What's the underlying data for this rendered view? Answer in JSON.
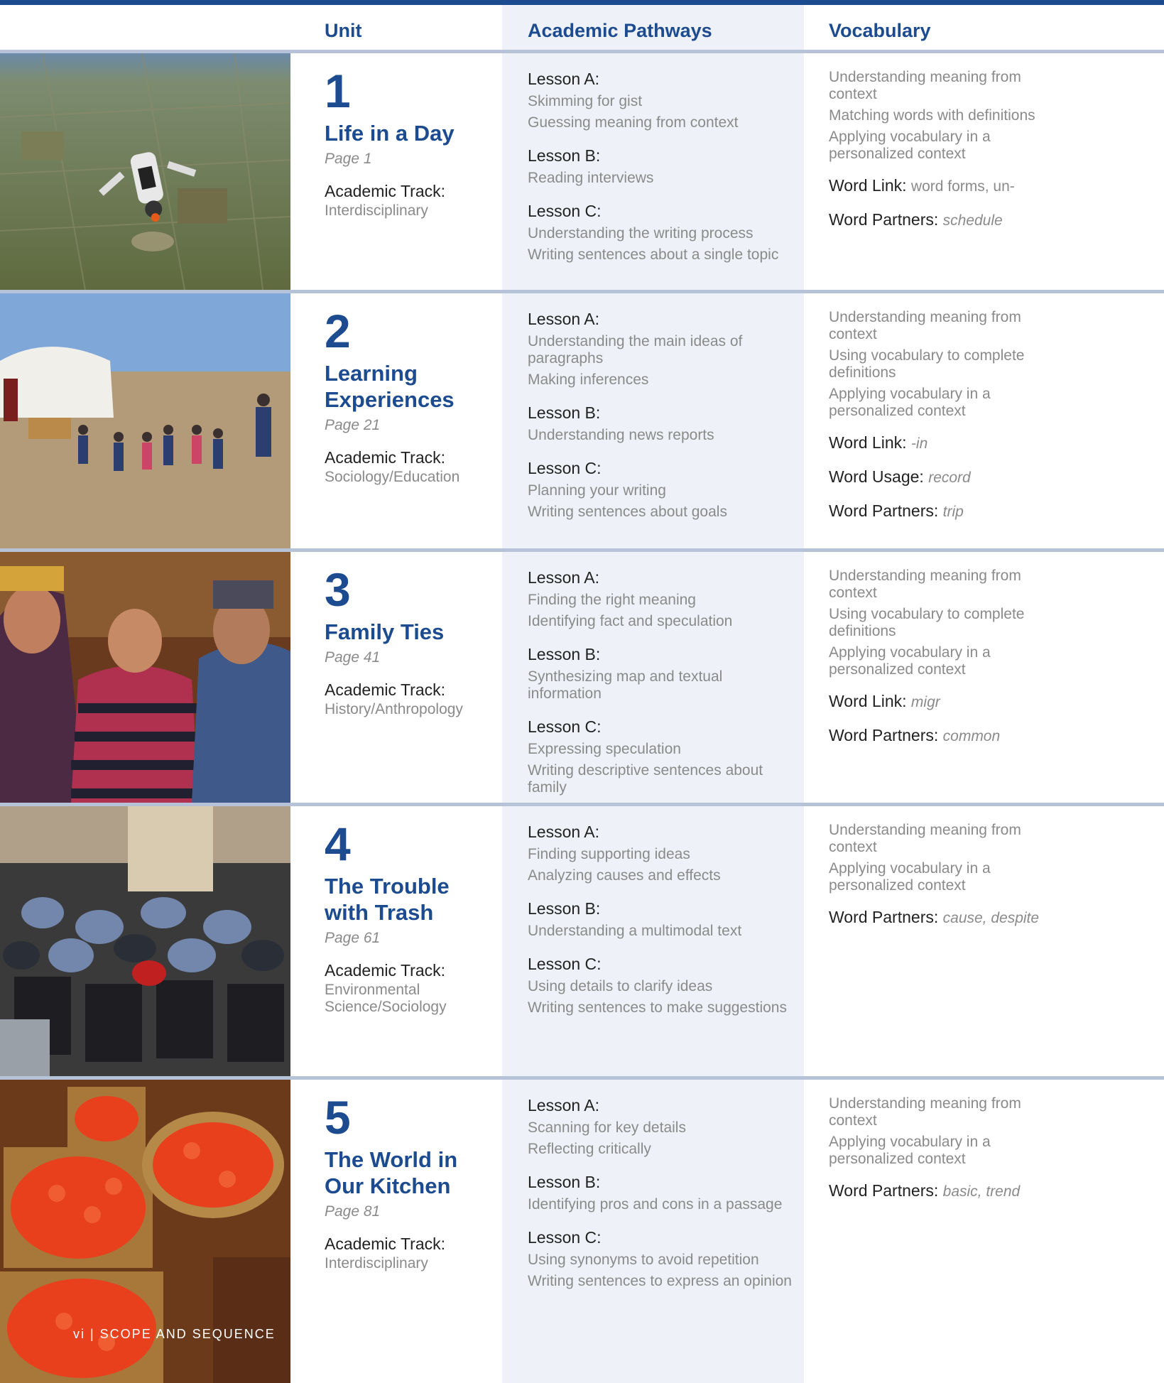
{
  "header": {
    "unit": "Unit",
    "pathways": "Academic Pathways",
    "vocabulary": "Vocabulary"
  },
  "units": [
    {
      "number": "1",
      "title": "Life in a Day",
      "page": "Page 1",
      "track_label": "Academic Track:",
      "track": "Interdisciplinary",
      "photo": "skydiver-aerial-photo",
      "lessons": [
        {
          "label": "Lesson A:",
          "items": [
            "Skimming for gist",
            "Guessing meaning from context"
          ]
        },
        {
          "label": "Lesson B:",
          "items": [
            "Reading interviews"
          ]
        },
        {
          "label": "Lesson C:",
          "items": [
            "Understanding the writing process",
            "Writing sentences about a single topic"
          ]
        }
      ],
      "vocab_items": [
        "Understanding meaning from context",
        "Matching words with definitions",
        "Applying vocabulary in a personalized context"
      ],
      "vocab_links": [
        {
          "label": "Word Link:",
          "value": "word forms, un-",
          "value_italic": false
        },
        {
          "label": "Word Partners:",
          "value": "schedule",
          "value_italic": true
        }
      ]
    },
    {
      "number": "2",
      "title": "Learning Experiences",
      "page": "Page 21",
      "track_label": "Academic Track:",
      "track": "Sociology/Education",
      "photo": "yurt-children-photo",
      "lessons": [
        {
          "label": "Lesson A:",
          "items": [
            "Understanding the main ideas of paragraphs",
            "Making inferences"
          ]
        },
        {
          "label": "Lesson B:",
          "items": [
            "Understanding news reports"
          ]
        },
        {
          "label": "Lesson C:",
          "items": [
            "Planning your writing",
            "Writing sentences about goals"
          ]
        }
      ],
      "vocab_items": [
        "Understanding meaning from context",
        "Using vocabulary to complete definitions",
        "Applying vocabulary in a personalized context"
      ],
      "vocab_links": [
        {
          "label": "Word Link:",
          "value": "-in",
          "value_italic": true
        },
        {
          "label": "Word Usage:",
          "value": "record",
          "value_italic": true
        },
        {
          "label": "Word Partners:",
          "value": "trip",
          "value_italic": true
        }
      ]
    },
    {
      "number": "3",
      "title": "Family Ties",
      "page": "Page 41",
      "track_label": "Academic Track:",
      "track": "History/Anthropology",
      "photo": "family-portrait-photo",
      "lessons": [
        {
          "label": "Lesson A:",
          "items": [
            "Finding the right meaning",
            "Identifying fact and speculation"
          ]
        },
        {
          "label": "Lesson B:",
          "items": [
            "Synthesizing map and textual information"
          ]
        },
        {
          "label": "Lesson C:",
          "items": [
            "Expressing speculation",
            "Writing descriptive sentences about family"
          ]
        }
      ],
      "vocab_items": [
        "Understanding meaning from context",
        "Using vocabulary to complete definitions",
        "Applying vocabulary in a personalized context"
      ],
      "vocab_links": [
        {
          "label": "Word Link:",
          "value": "migr",
          "value_italic": true
        },
        {
          "label": "Word Partners:",
          "value": "common",
          "value_italic": true
        }
      ]
    },
    {
      "number": "4",
      "title": "The Trouble with Trash",
      "page": "Page 61",
      "track_label": "Academic Track:",
      "track": "Environmental Science/Sociology",
      "photo": "trash-bags-photo",
      "lessons": [
        {
          "label": "Lesson A:",
          "items": [
            "Finding supporting ideas",
            "Analyzing causes and effects"
          ]
        },
        {
          "label": "Lesson B:",
          "items": [
            "Understanding a multimodal text"
          ]
        },
        {
          "label": "Lesson C:",
          "items": [
            "Using details to clarify ideas",
            "Writing sentences to make suggestions"
          ]
        }
      ],
      "vocab_items": [
        "Understanding meaning from context",
        "Applying vocabulary in a personalized context"
      ],
      "vocab_links": [
        {
          "label": "Word Partners:",
          "value": "cause, despite",
          "value_italic": true
        }
      ]
    },
    {
      "number": "5",
      "title": "The World in Our Kitchen",
      "page": "Page 81",
      "track_label": "Academic Track:",
      "track": "Interdisciplinary",
      "photo": "tomato-baskets-photo",
      "lessons": [
        {
          "label": "Lesson A:",
          "items": [
            "Scanning for key details",
            "Reflecting critically"
          ]
        },
        {
          "label": "Lesson B:",
          "items": [
            "Identifying pros and cons in a passage"
          ]
        },
        {
          "label": "Lesson C:",
          "items": [
            "Using synonyms to avoid repetition",
            "Writing sentences to express an opinion"
          ]
        }
      ],
      "vocab_items": [
        "Understanding meaning from context",
        "Applying vocabulary in a personalized context"
      ],
      "vocab_links": [
        {
          "label": "Word Partners:",
          "value": "basic, trend",
          "value_italic": true
        }
      ]
    }
  ],
  "footer": "vi  |  SCOPE AND SEQUENCE"
}
